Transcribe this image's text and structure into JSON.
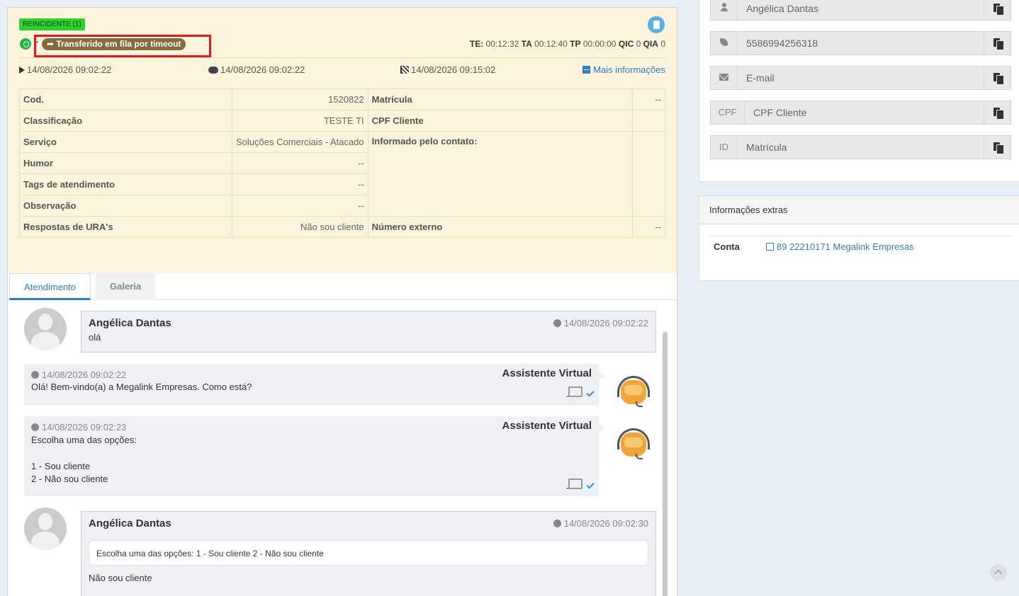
{
  "header": {
    "reincidente": "REINCIDENTE (1)",
    "transfer_badge": "Transferido em fila por timeout",
    "metrics": {
      "te_label": "TE:",
      "te_value": "00:12:32",
      "ta_label": "TA",
      "ta_value": "00:12:40",
      "tp_label": "TP",
      "tp_value": "00:00:00",
      "qic_label": "QIC",
      "qic_value": "0",
      "qia_label": "QIA",
      "qia_value": "0"
    },
    "start_time": "14/08/2026 09:02:22",
    "chat_time": "14/08/2026 09:02:22",
    "end_time": "14/08/2026 09:15:02",
    "more_info": "Mais informações"
  },
  "info_table": {
    "left": [
      {
        "label": "Cod.",
        "value": "1520822"
      },
      {
        "label": "Classificação",
        "value": "TESTE TI"
      },
      {
        "label": "Serviço",
        "value": "Soluções Comerciais - Atacado"
      },
      {
        "label": "Humor",
        "value": "--"
      },
      {
        "label": "Tags de atendimento",
        "value": "--"
      },
      {
        "label": "Observação",
        "value": "--"
      },
      {
        "label": "Respostas de URA's",
        "value": "Não sou cliente"
      }
    ],
    "right": [
      {
        "label": "Matrícula",
        "value": "--"
      },
      {
        "label": "CPF Cliente",
        "value": ""
      },
      {
        "label": "Informado pelo contato:",
        "value": ""
      },
      {
        "label": "Número externo",
        "value": "--"
      }
    ]
  },
  "tabs": [
    {
      "label": "Atendimento",
      "active": true
    },
    {
      "label": "Galeria",
      "active": false
    }
  ],
  "messages": [
    {
      "sender": "Angélica Dantas",
      "time": "14/08/2026 09:02:22",
      "text": "olá"
    },
    {
      "sender": "Assistente Virtual",
      "time": "14/08/2026 09:02:22",
      "text": "Olá! Bem-vindo(a) a Megalink Empresas. Como está?"
    },
    {
      "sender": "Assistente Virtual",
      "time": "14/08/2026 09:02:23",
      "lines": [
        "Escolha uma das opções:",
        "",
        "1 - Sou cliente",
        "2 - Não sou cliente"
      ]
    },
    {
      "sender": "Angélica Dantas",
      "time": "14/08/2026 09:02:30",
      "quote": "Escolha uma das opções: 1 - Sou cliente 2 - Não sou cliente",
      "text": "Não sou cliente"
    }
  ],
  "contact": {
    "name": "Angélica Dantas",
    "phone": "5586994256318",
    "email_placeholder": "E-mail",
    "cpf_addon": "CPF",
    "cpf_placeholder": "CPF Cliente",
    "id_addon": "ID",
    "id_placeholder": "Matrícula"
  },
  "extras": {
    "title": "Informações extras",
    "account_label": "Conta",
    "account_value": "89 22210171 Megalink Empresas"
  },
  "colors": {
    "header_bg": "#fcf3dc",
    "accent": "#2a7fc2",
    "badge_green": "#2ed12e",
    "transfer_brown": "#856b3c",
    "highlight_red": "#e01b1b"
  }
}
